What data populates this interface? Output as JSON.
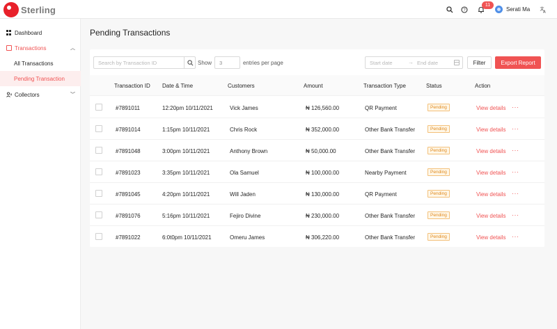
{
  "brand": {
    "name": "Sterling",
    "accent": "#f05353"
  },
  "topbar": {
    "notification_count": "11",
    "user_name": "Serati Ma",
    "icons": [
      "search-icon",
      "help-icon",
      "bell-icon",
      "translate-icon"
    ]
  },
  "sidebar": {
    "dashboard": "Dashboard",
    "transactions": "Transactions",
    "all_transactions": "All Transactions",
    "pending_transaction": "Pending Transaction",
    "collectors": "Collectors"
  },
  "page": {
    "title": "Pending Transactions"
  },
  "toolbar": {
    "search_placeholder": "Search by Transaction ID",
    "show_label": "Show",
    "entries_value": "3",
    "entries_label": "entries per page",
    "start_date": "Start date",
    "end_date": "End date",
    "filter_label": "Filter",
    "export_label": "Export Report"
  },
  "table": {
    "headers": [
      "Transaction ID",
      "Date & Time",
      "Customers",
      "Amount",
      "Transaction Type",
      "Status",
      "Action"
    ],
    "rows": [
      {
        "id": "#7891011",
        "datetime": "12:20pm 10/11/2021",
        "customer": "Vick James",
        "amount": "₦ 126,560.00",
        "type": "QR Payment",
        "status": "Pending",
        "action": "View details"
      },
      {
        "id": "#7891014",
        "datetime": "1:15pm 10/11/2021",
        "customer": "Chris Rock",
        "amount": "₦ 352,000.00",
        "type": "Other Bank Transfer",
        "status": "Pending",
        "action": "View details"
      },
      {
        "id": "#7891048",
        "datetime": "3:00pm 10/11/2021",
        "customer": "Anthony Brown",
        "amount": "₦ 50,000.00",
        "type": "Other Bank Transfer",
        "status": "Pending",
        "action": "View details"
      },
      {
        "id": "#7891023",
        "datetime": "3:35pm 10/11/2021",
        "customer": "Ola Samuel",
        "amount": "₦ 100,000.00",
        "type": "Nearby Payment",
        "status": "Pending",
        "action": "View details"
      },
      {
        "id": "#7891045",
        "datetime": "4:20pm 10/11/2021",
        "customer": "Will Jaden",
        "amount": "₦ 130,000.00",
        "type": "QR Payment",
        "status": "Pending",
        "action": "View details"
      },
      {
        "id": "#7891076",
        "datetime": "5:16pm 10/11/2021",
        "customer": "Fejiro Divine",
        "amount": "₦ 230,000.00",
        "type": "Other Bank Transfer",
        "status": "Pending",
        "action": "View details"
      },
      {
        "id": "#7891022",
        "datetime": "6:0t0pm 10/11/2021",
        "customer": "Omeru James",
        "amount": "₦ 306,220.00",
        "type": "Other Bank Transfer",
        "status": "Pending",
        "action": "View details"
      }
    ],
    "more_label": "···"
  }
}
